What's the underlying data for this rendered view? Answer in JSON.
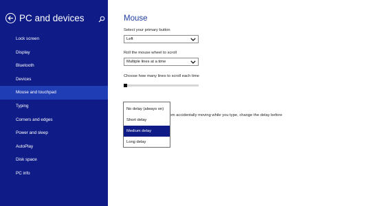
{
  "sidebar": {
    "title": "PC and devices",
    "icons": {
      "back": "back-arrow-icon",
      "search": "search-icon"
    },
    "items": [
      {
        "label": "Lock screen"
      },
      {
        "label": "Display"
      },
      {
        "label": "Bluetooth"
      },
      {
        "label": "Devices"
      },
      {
        "label": "Mouse and touchpad",
        "active": true
      },
      {
        "label": "Typing"
      },
      {
        "label": "Corners and edges"
      },
      {
        "label": "Power and sleep"
      },
      {
        "label": "AutoPlay"
      },
      {
        "label": "Disk space"
      },
      {
        "label": "PC info"
      }
    ]
  },
  "main": {
    "title": "Mouse",
    "primary_button": {
      "label": "Select your primary button",
      "value": "Left"
    },
    "scroll_wheel": {
      "label": "Roll the mouse wheel to scroll",
      "value": "Multiple lines at a time"
    },
    "lines_slider": {
      "label": "Choose how many lines to scroll each time",
      "level": 0.03
    },
    "touchpad": {
      "heading_partial": "Touchpad",
      "description_partial": "from accidentally moving while you type, change the delay before"
    }
  },
  "delay_dropdown": {
    "options": [
      "No delay (always on)",
      "Short delay",
      "Medium delay",
      "Long delay"
    ],
    "selected": "Medium delay"
  },
  "colors": {
    "sidebar_bg": "#0f1c88",
    "sidebar_active": "#1f3db5",
    "accent_title": "#1f3d9e",
    "dropdown_selected": "#0f1c88"
  }
}
